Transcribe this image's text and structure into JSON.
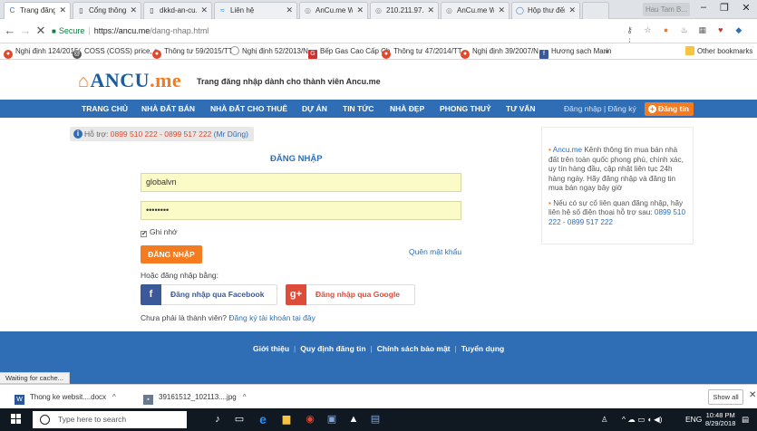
{
  "browser": {
    "tabs": [
      {
        "title": "Trang đăng n",
        "favicon": "ancu-icon",
        "active": true
      },
      {
        "title": "Cổng thông t",
        "favicon": "page-icon"
      },
      {
        "title": "dkkd-an-cu.p",
        "favicon": "page-icon"
      },
      {
        "title": "Liên hệ",
        "favicon": "liquid-icon"
      },
      {
        "title": "AnCu.me WH",
        "favicon": "ancu-icon"
      },
      {
        "title": "210.211.97.8",
        "favicon": "ancu-icon"
      },
      {
        "title": "AnCu.me WH",
        "favicon": "ancu-icon"
      },
      {
        "title": "Hộp thư đến",
        "favicon": "mail-icon"
      }
    ],
    "profile_name": "Hau Tam B...",
    "secure_label": "Secure",
    "url_host": "https://ancu.me",
    "url_path": "/dang-nhap.html",
    "bookmarks": [
      "Nghị định 124/2015/",
      "COSS (COSS) price, c",
      "Thông tư 59/2015/TT",
      "Nghị định 52/2013/N",
      "Bếp Gas Cao Cấp Ch",
      "Thông tư 47/2014/TT",
      "Nghị định 39/2007/N",
      "Hương sạch Marin",
      "»",
      "Other bookmarks"
    ]
  },
  "site": {
    "logo_text": "ANCU",
    "logo_suffix": ".me",
    "tagline": "Trang đăng nhập dành cho thành viên Ancu.me",
    "nav": [
      "TRANG CHỦ",
      "NHÀ ĐẤT BÁN",
      "NHÀ ĐẤT CHO THUÊ",
      "DỰ ÁN",
      "TIN TỨC",
      "NHÀ ĐẸP",
      "PHONG THUỶ",
      "TƯ VẤN"
    ],
    "nav_auth": "Đăng nhập | Đăng ký",
    "post_button": "Đăng tin"
  },
  "login": {
    "support_label": "Hỗ trợ:",
    "support_phones": "0899 510 222 - 0899 517 222",
    "support_person": "(Mr Dũng)",
    "title": "ĐĂNG NHẬP",
    "username_value": "globalvn",
    "password_value": "••••••••",
    "remember_label": "Ghi nhớ",
    "submit_label": "ĐĂNG NHẬP",
    "forgot_label": "Quên mật khẩu",
    "or_label": "Hoặc đăng nhập bằng:",
    "facebook_label": "Đăng nhập qua Facebook",
    "google_label": "Đăng nhập qua Google",
    "signup_prefix": "Chưa phải là thành viên?",
    "signup_link": "Đăng ký tài khoản tại đây"
  },
  "sidebar": {
    "para1_brand": "Ancu.me",
    "para1_text": " Kênh thông tin mua bán nhà đất trên toàn quốc phong phú, chính xác, uy tín hàng đầu, cập nhật liên tục 24h hàng ngày. Hãy đăng nhập và đăng tin mua bán ngay bây giờ",
    "para2_text": "Nếu có sự cố liên quan đăng nhập, hãy liên hệ số điện thoại hỗ trợ sau:",
    "para2_phones": "0899 510 222 - 0899 517 222"
  },
  "footer": {
    "links": [
      "Giới thiệu",
      "Quy định đăng tin",
      "Chính sách bảo mật",
      "Tuyển dụng"
    ]
  },
  "status_text": "Waiting for cache...",
  "downloads": {
    "items": [
      "Thong ke websit....docx",
      "39161512_102113....jpg"
    ],
    "show_all": "Show all"
  },
  "taskbar": {
    "search_placeholder": "Type here to search",
    "lang": "ENG",
    "time": "10:48 PM",
    "date": "8/29/2018"
  },
  "colors": {
    "brand_blue": "#2f6eb5",
    "brand_orange": "#f47b20",
    "facebook": "#3b5998",
    "google": "#dd4b39",
    "input_bg": "#fbfbc8"
  }
}
